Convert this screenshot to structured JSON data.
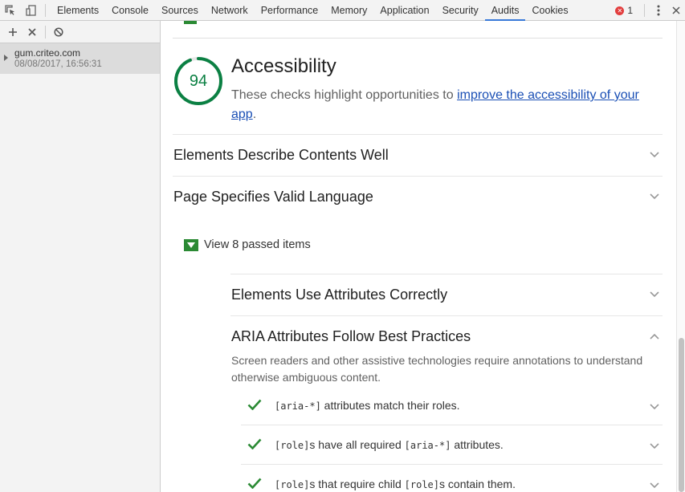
{
  "devtools": {
    "tabs": [
      {
        "label": "Elements"
      },
      {
        "label": "Console"
      },
      {
        "label": "Sources"
      },
      {
        "label": "Network"
      },
      {
        "label": "Performance"
      },
      {
        "label": "Memory"
      },
      {
        "label": "Application"
      },
      {
        "label": "Security"
      },
      {
        "label": "Audits",
        "active": true
      },
      {
        "label": "Cookies"
      }
    ],
    "error_count": "1",
    "accent_color": "#3879d9",
    "error_color": "#e23d3d"
  },
  "sidebar": {
    "report": {
      "host": "gum.criteo.com",
      "datetime": "08/08/2017, 16:56:31"
    }
  },
  "category": {
    "score": "94",
    "score_fraction": 0.94,
    "score_color": "#0b8043",
    "title": "Accessibility",
    "description_prefix": "These checks highlight opportunities to ",
    "description_link": "improve the accessibility of your app",
    "description_suffix": "."
  },
  "groups": [
    {
      "title": "Elements Describe Contents Well"
    },
    {
      "title": "Page Specifies Valid Language"
    }
  ],
  "passed": {
    "label": "View 8 passed items",
    "color": "#2b8a34",
    "groups": [
      {
        "title": "Elements Use Attributes Correctly"
      },
      {
        "title": "ARIA Attributes Follow Best Practices",
        "description": "Screen readers and other assistive technologies require annotations to understand otherwise ambiguous content.",
        "audits": [
          {
            "code1": "[aria-*]",
            "text1": " attributes match their roles."
          },
          {
            "code1": "[role]",
            "text1": "s have all required ",
            "code2": "[aria-*]",
            "text2": " attributes."
          },
          {
            "code1": "[role]",
            "text1": "s that require child ",
            "code2": "[role]",
            "text2": "s contain them."
          }
        ]
      }
    ]
  }
}
